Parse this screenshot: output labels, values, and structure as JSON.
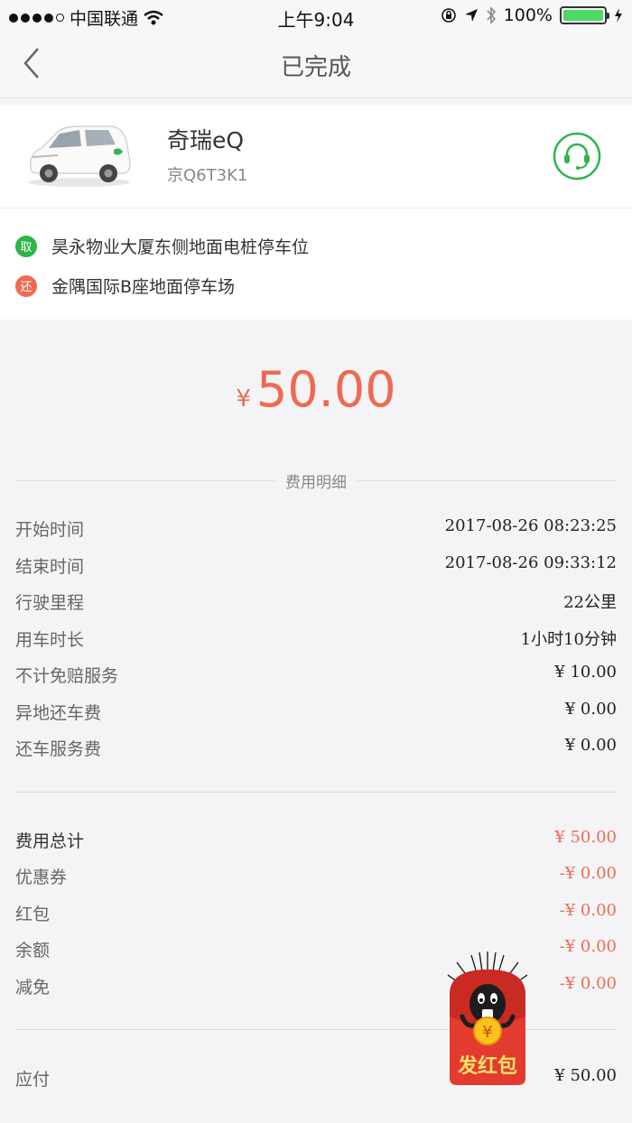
{
  "status_bar": {
    "carrier": "中国联通",
    "time": "上午9:04",
    "battery": "100%"
  },
  "nav": {
    "title": "已完成"
  },
  "car": {
    "name": "奇瑞eQ",
    "plate": "京Q6T3K1"
  },
  "locations": {
    "pickup_tag": "取",
    "pickup": "昊永物业大厦东侧地面电桩停车位",
    "return_tag": "还",
    "return": "金隅国际B座地面停车场"
  },
  "total": {
    "currency": "¥",
    "amount": "50.00"
  },
  "fee_detail": {
    "title": "费用明细",
    "rows": [
      {
        "label": "开始时间",
        "value": "2017-08-26 08:23:25"
      },
      {
        "label": "结束时间",
        "value": "2017-08-26 09:33:12"
      },
      {
        "label": "行驶里程",
        "value": "22公里"
      },
      {
        "label": "用车时长",
        "value": "1小时10分钟"
      },
      {
        "label": "不计免赔服务",
        "value": "¥ 10.00"
      },
      {
        "label": "异地还车费",
        "value": "¥ 0.00"
      },
      {
        "label": "还车服务费",
        "value": "¥ 0.00"
      }
    ]
  },
  "summary": {
    "rows": [
      {
        "label": "费用总计",
        "value": "¥ 50.00"
      },
      {
        "label": "优惠券",
        "value": "-¥ 0.00"
      },
      {
        "label": "红包",
        "value": "-¥ 0.00"
      },
      {
        "label": "余额",
        "value": "-¥ 0.00"
      },
      {
        "label": "减免",
        "value": "-¥ 0.00"
      }
    ]
  },
  "payable": {
    "label": "应付",
    "value": "¥ 50.00"
  },
  "red_packet": {
    "label": "发红包",
    "coin": "¥"
  },
  "colors": {
    "accent": "#ee6a52",
    "green": "#2db54a"
  }
}
